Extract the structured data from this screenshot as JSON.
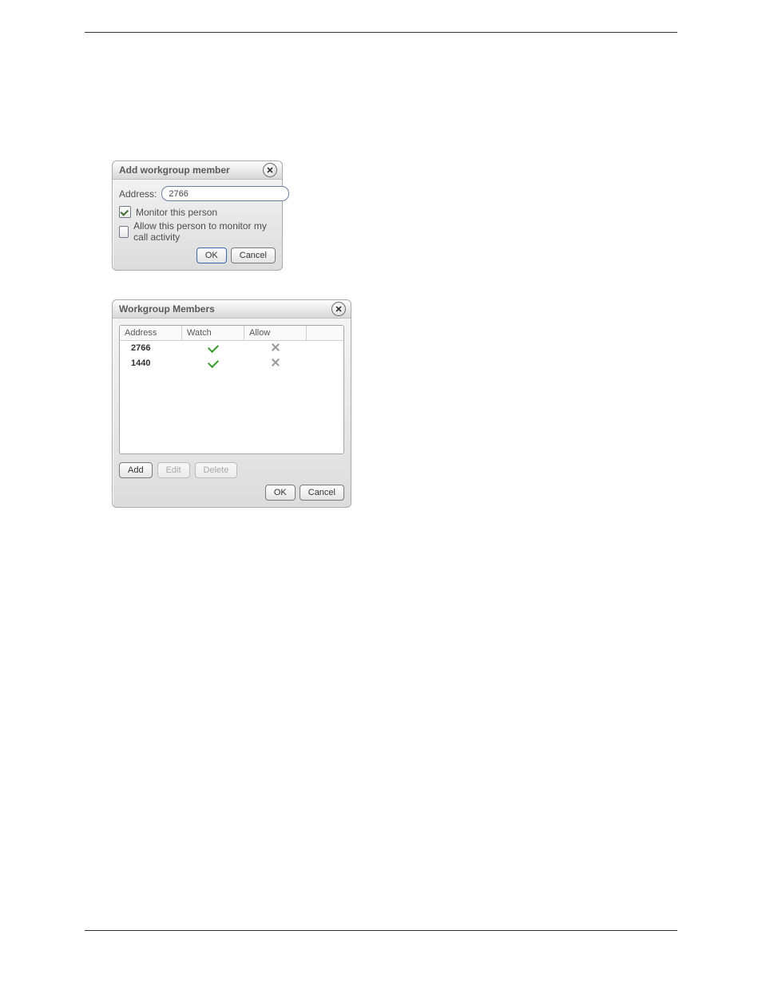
{
  "addDialog": {
    "title": "Add workgroup member",
    "addressLabel": "Address:",
    "addressValue": "2766",
    "monitorLabel": "Monitor this person",
    "monitorChecked": true,
    "allowLabel": "Allow this person to monitor my call activity",
    "allowChecked": false,
    "okLabel": "OK",
    "cancelLabel": "Cancel"
  },
  "membersDialog": {
    "title": "Workgroup Members",
    "columns": {
      "address": "Address",
      "watch": "Watch",
      "allow": "Allow"
    },
    "rows": [
      {
        "address": "2766",
        "watch": true,
        "allow": false
      },
      {
        "address": "1440",
        "watch": true,
        "allow": false
      }
    ],
    "addLabel": "Add",
    "editLabel": "Edit",
    "deleteLabel": "Delete",
    "okLabel": "OK",
    "cancelLabel": "Cancel"
  }
}
